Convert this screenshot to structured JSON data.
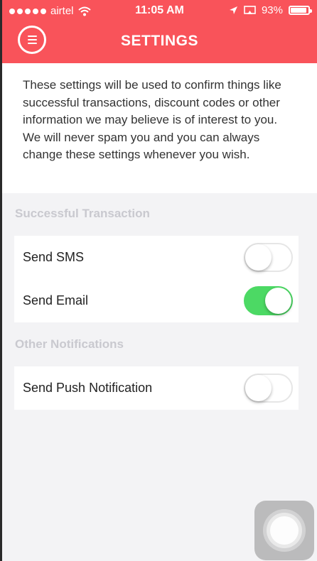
{
  "status_bar": {
    "carrier": "airtel",
    "time": "11:05 AM",
    "battery": "93%",
    "battery_level": 0.93,
    "icons": [
      "signal-dots-icon",
      "wifi-icon",
      "location-arrow-icon",
      "screen-mirror-icon",
      "battery-icon"
    ]
  },
  "header": {
    "title": "SETTINGS",
    "menu_icon": "menu-icon",
    "color": "#f9535a"
  },
  "intro_text": "These settings will be used to confirm things like successful transactions, discount codes or other information we may believe is of interest to you. We will never spam you and you can always change these settings whenever you wish.",
  "sections": [
    {
      "label": "Successful Transaction",
      "items": [
        {
          "label": "Send SMS",
          "enabled": false
        },
        {
          "label": "Send Email",
          "enabled": true
        }
      ]
    },
    {
      "label": "Other Notifications",
      "items": [
        {
          "label": "Send Push Notification",
          "enabled": false
        }
      ]
    }
  ],
  "colors": {
    "toggle_on": "#4cd964",
    "section_label": "#c9c9cf"
  }
}
